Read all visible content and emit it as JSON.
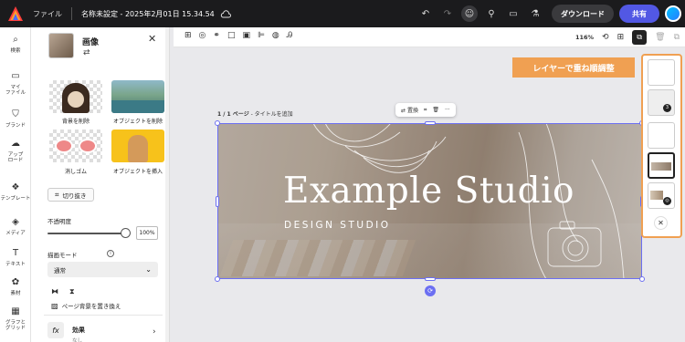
{
  "topbar": {
    "file_menu": "ファイル",
    "doc_title": "名称未設定 - 2025年2月01日 15.34.54",
    "download_label": "ダウンロード",
    "share_label": "共有"
  },
  "rail": {
    "items": [
      {
        "label": "検索",
        "icon": "search-icon"
      },
      {
        "label": "マイ\nファイル",
        "icon": "folder-icon"
      },
      {
        "label": "ブランド",
        "icon": "brand-icon"
      },
      {
        "label": "アップ\nロード",
        "icon": "upload-icon"
      },
      {
        "label": "テンプレート",
        "icon": "template-icon"
      },
      {
        "label": "メディア",
        "icon": "media-icon"
      },
      {
        "label": "テキスト",
        "icon": "text-icon"
      },
      {
        "label": "素材",
        "icon": "elements-icon"
      },
      {
        "label": "グラフと\nグリッド",
        "icon": "grid-icon"
      }
    ]
  },
  "panel": {
    "title": "画像",
    "tools": [
      {
        "label": "背景を削除"
      },
      {
        "label": "オブジェクトを削除"
      },
      {
        "label": "消しゴム"
      },
      {
        "label": "オブジェクトを挿入"
      }
    ],
    "crop_label": "切り抜き",
    "opacity_label": "不透明度",
    "opacity_value": "100%",
    "opacity_level": 1.0,
    "blend_label": "描画モード",
    "blend_value": "通常",
    "replace_bg_label": "ページ背景を置き換え",
    "effects_title": "効果",
    "effects_sub": "なし"
  },
  "toolstrip": {
    "zoom": "116%"
  },
  "canvas": {
    "page_prefix": "1 / 1 ページ",
    "page_title_placeholder": " - タイトルを追加",
    "ctx_replace": "置換",
    "banner_title": "Example Studio",
    "banner_subtitle": "DESIGN STUDIO"
  },
  "callout": {
    "text": "レイヤーで重ね順調整"
  },
  "layers": {
    "badge_count": "3"
  },
  "colors": {
    "accent": "#5258e4",
    "selection": "#6c6ff2",
    "callout": "#f0a052",
    "topbar": "#1b1b1d"
  }
}
